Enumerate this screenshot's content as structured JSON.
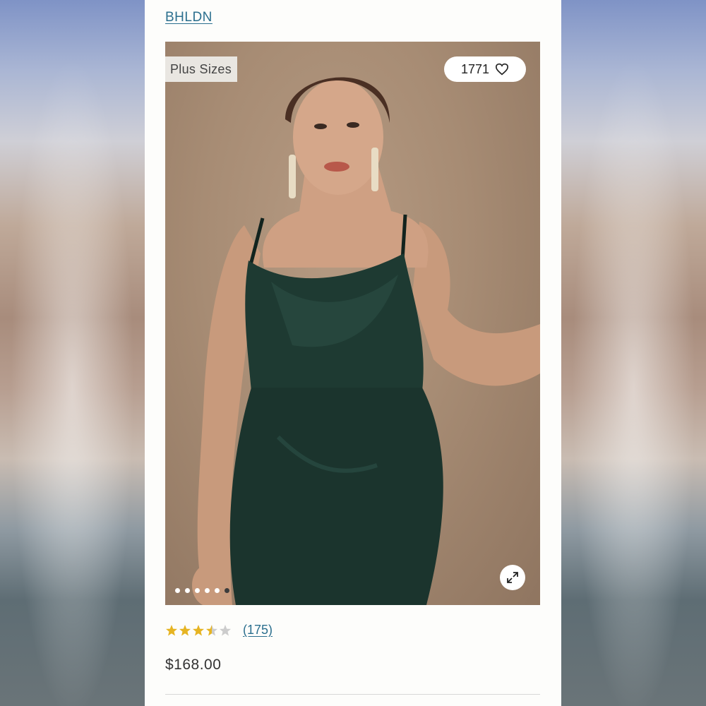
{
  "product": {
    "brand": "BHLDN",
    "badge": "Plus Sizes",
    "likes": "1771",
    "rating": 3.5,
    "review_count": "(175)",
    "price": "$168.00",
    "image_count": 6,
    "active_image": 6
  },
  "icons": {
    "like": "heart-icon",
    "expand": "expand-icon",
    "star": "star-icon"
  },
  "colors": {
    "link": "#2b6f8e",
    "star_filled": "#e6b422",
    "star_empty": "#cccccc",
    "dress": "#1e3a32"
  }
}
